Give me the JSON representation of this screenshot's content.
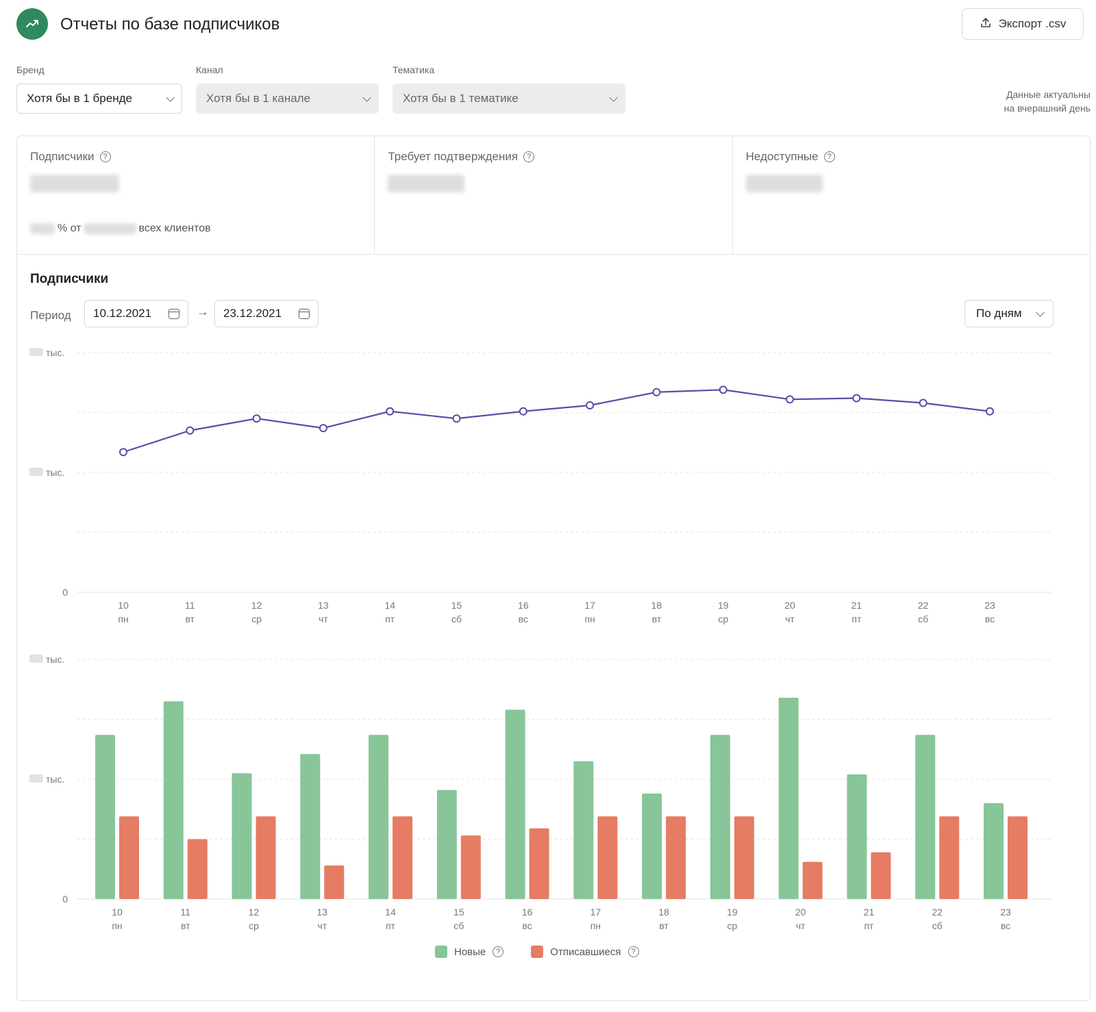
{
  "header": {
    "title": "Отчеты по базе подписчиков",
    "export_label": "Экспорт .csv",
    "logo_icon": "trending-up-icon",
    "logo_color": "#2f8a5f"
  },
  "filters": {
    "brand": {
      "label": "Бренд",
      "value": "Хотя бы в 1 бренде"
    },
    "channel": {
      "label": "Канал",
      "value": "Хотя бы в 1 канале"
    },
    "topic": {
      "label": "Тематика",
      "value": "Хотя бы в 1 тематике"
    },
    "note_line1": "Данные актуальны",
    "note_line2": "на вчерашний день"
  },
  "stats": {
    "subscribers": {
      "title": "Подписчики",
      "sub_percent_suffix": "% от",
      "sub_tail": "всех клиентов"
    },
    "pending": {
      "title": "Требует подтверждения"
    },
    "unavailable": {
      "title": "Недоступные"
    }
  },
  "section": {
    "title": "Подписчики",
    "period_label": "Период",
    "date_from": "10.12.2021",
    "date_to": "23.12.2021",
    "arrow": "→",
    "granularity": "По дням"
  },
  "legend": {
    "new_label": "Новые",
    "unsub_label": "Отписавшиеся",
    "new_color": "#88c598",
    "unsub_color": "#e57c63"
  },
  "chart_data": [
    {
      "type": "line",
      "x": [
        "10",
        "11",
        "12",
        "13",
        "14",
        "15",
        "16",
        "17",
        "18",
        "19",
        "20",
        "21",
        "22",
        "23"
      ],
      "weekdays": [
        "пн",
        "вт",
        "ср",
        "чт",
        "пт",
        "сб",
        "вс",
        "пн",
        "вт",
        "ср",
        "чт",
        "пт",
        "сб",
        "вс"
      ],
      "y_ticks": [
        "тыс.",
        "тыс.",
        "0"
      ],
      "series": [
        {
          "values": [
            58.5,
            67.5,
            72.5,
            68.5,
            75.5,
            72.5,
            75.5,
            78.0,
            83.5,
            84.5,
            80.5,
            81.0,
            79.0,
            75.5
          ]
        }
      ],
      "ylim": [
        0,
        100
      ],
      "color": "#5b4ba8",
      "grid": true
    },
    {
      "type": "bar",
      "categories": [
        "10",
        "11",
        "12",
        "13",
        "14",
        "15",
        "16",
        "17",
        "18",
        "19",
        "20",
        "21",
        "22",
        "23"
      ],
      "weekdays": [
        "пн",
        "вт",
        "ср",
        "чт",
        "пт",
        "сб",
        "вс",
        "пн",
        "вт",
        "ср",
        "чт",
        "пт",
        "сб",
        "вс"
      ],
      "y_ticks": [
        "тыс.",
        "тыс.",
        "0"
      ],
      "series": [
        {
          "name": "Новые",
          "values": [
            68.5,
            82.5,
            52.5,
            60.5,
            68.5,
            45.5,
            79.0,
            57.5,
            44.0,
            68.5,
            84.0,
            52.0,
            68.5,
            40.0
          ]
        },
        {
          "name": "Отписавшиеся",
          "values": [
            34.5,
            25.0,
            34.5,
            14.0,
            34.5,
            26.5,
            29.5,
            34.5,
            34.5,
            34.5,
            15.5,
            19.5,
            34.5,
            34.5
          ]
        }
      ],
      "ylim": [
        0,
        100
      ],
      "colors": [
        "#88c598",
        "#e57c63"
      ],
      "grid": true
    }
  ]
}
